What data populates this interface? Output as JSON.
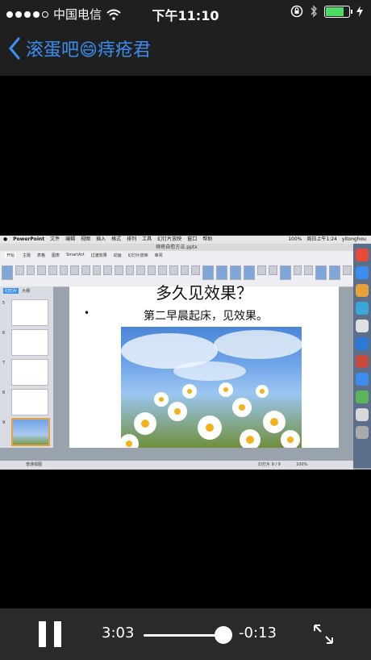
{
  "status_bar": {
    "carrier": "中国电信",
    "time": "下午11:10",
    "battery_level": 0.85
  },
  "nav": {
    "back_title": "滚蛋吧😄痔疮君"
  },
  "video_frame": {
    "menubar": {
      "app": "PowerPoint",
      "items": [
        "文件",
        "编辑",
        "视图",
        "插入",
        "格式",
        "排列",
        "工具",
        "幻灯片放映",
        "窗口",
        "帮助"
      ],
      "right_zoom": "100%",
      "right_clock": "周日上午1:24",
      "right_user": "yitonghou"
    },
    "window_title": "痔疮自愈方法.pptx",
    "ribbon_tabs": [
      "开始",
      "主题",
      "表格",
      "图表",
      "SmartArt",
      "过渡效果",
      "动画",
      "幻灯片放映",
      "审阅"
    ],
    "sidebar_tabs": [
      "幻灯片",
      "大纲"
    ],
    "thumb_numbers": [
      "5",
      "6",
      "7",
      "8",
      "9"
    ],
    "slide": {
      "title": "多久见效果？",
      "bullet": "•",
      "body": "第二早晨起床，见效果。"
    },
    "status_line": {
      "view": "普通视图",
      "slide_info": "幻灯片 9 / 9",
      "zoom": "100%"
    }
  },
  "player": {
    "elapsed": "3:03",
    "remaining": "-0:13",
    "progress": 0.93
  }
}
